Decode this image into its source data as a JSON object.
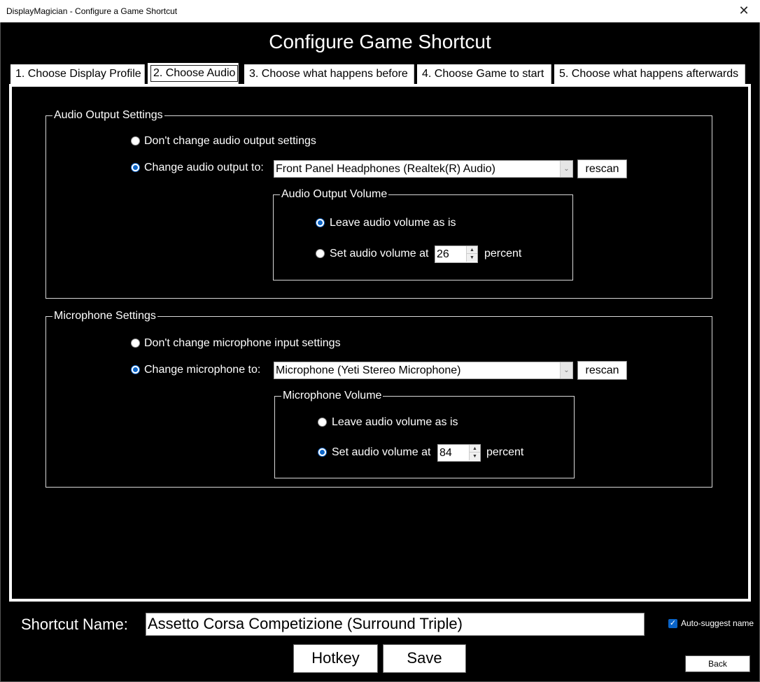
{
  "window": {
    "title": "DisplayMagician - Configure a Game Shortcut",
    "close_glyph": "✕"
  },
  "heading": "Configure Game Shortcut",
  "tabs": [
    {
      "label": "1. Choose Display Profile"
    },
    {
      "label": "2. Choose Audio",
      "active": true
    },
    {
      "label": "3. Choose what happens before"
    },
    {
      "label": "4. Choose Game to start"
    },
    {
      "label": "5. Choose what happens afterwards"
    }
  ],
  "audio_output": {
    "group_label": "Audio Output Settings",
    "dont_change_label": "Don't change audio output settings",
    "change_label": "Change audio output to:",
    "selected_option": "change",
    "device": "Front Panel Headphones (Realtek(R) Audio)",
    "rescan_label": "rescan",
    "volume": {
      "group_label": "Audio Output Volume",
      "leave_label": "Leave audio volume as is",
      "set_label": "Set audio volume at",
      "selected_option": "leave",
      "value": "26",
      "unit": "percent"
    }
  },
  "microphone": {
    "group_label": "Microphone Settings",
    "dont_change_label": "Don't change microphone input settings",
    "change_label": "Change microphone to:",
    "selected_option": "change",
    "device": "Microphone (Yeti Stereo Microphone)",
    "rescan_label": "rescan",
    "volume": {
      "group_label": "Microphone Volume",
      "leave_label": "Leave audio volume as is",
      "set_label": "Set audio volume at",
      "selected_option": "set",
      "value": "84",
      "unit": "percent"
    }
  },
  "shortcut": {
    "name_label": "Shortcut Name:",
    "name_value": "Assetto Corsa Competizione (Surround Triple)",
    "auto_suggest_label": "Auto-suggest name",
    "auto_suggest_checked": true
  },
  "buttons": {
    "hotkey": "Hotkey",
    "save": "Save",
    "back": "Back"
  },
  "icons": {
    "combo_arrow": "⌄",
    "spin_up": "▲",
    "spin_down": "▼",
    "check": "✓"
  },
  "colors": {
    "background": "#000000",
    "accent": "#0a64c8",
    "text": "#ffffff"
  }
}
